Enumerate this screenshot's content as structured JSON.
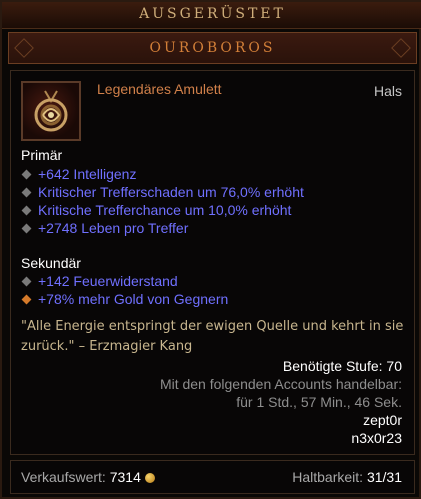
{
  "header": {
    "equipped_label": "AUSGERÜSTET"
  },
  "item": {
    "name": "OUROBOROS",
    "type": "Legendäres Amulett",
    "slot": "Hals",
    "icon": "amulet-icon"
  },
  "primary": {
    "title": "Primär",
    "stats": [
      "+642 Intelligenz",
      "Kritischer Trefferschaden um 76,0% erhöht",
      "Kritische Trefferchance um 10,0% erhöht",
      "+2748 Leben pro Treffer"
    ]
  },
  "secondary": {
    "title": "Sekundär",
    "stats": [
      "+142 Feuerwiderstand",
      "+78% mehr Gold von Gegnern"
    ]
  },
  "flavor": "\"Alle Energie entspringt der ewigen Quelle und kehrt in sie zurück.\" – Erzmagier Kang",
  "requirements": {
    "level": "Benötigte Stufe: 70",
    "tradeable": "Mit den folgenden Accounts handelbar:",
    "time": "für 1 Std., 57 Min., 46 Sek.",
    "accounts": [
      "zept0r",
      "n3x0r23"
    ]
  },
  "footer": {
    "sell_label": "Verkaufswert:",
    "sell_value": "7314",
    "durability_label": "Haltbarkeit:",
    "durability_value": "31/31"
  },
  "colors": {
    "legendary": "#d1804a",
    "affix": "#7070ff",
    "flavor": "#c8b68f"
  }
}
